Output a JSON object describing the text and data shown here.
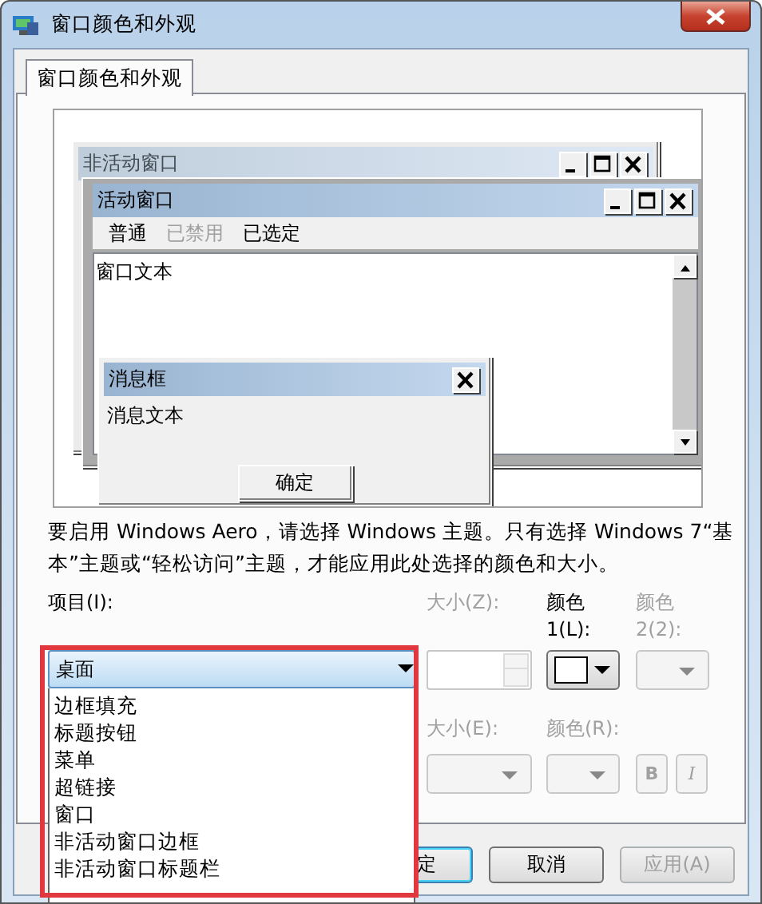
{
  "window": {
    "title": "窗口颜色和外观"
  },
  "tabs": [
    {
      "label": "窗口颜色和外观",
      "selected": true
    }
  ],
  "preview": {
    "inactive_window": {
      "title": "非活动窗口"
    },
    "active_window": {
      "title": "活动窗口",
      "menu": [
        {
          "label": "普通",
          "disabled": false
        },
        {
          "label": "已禁用",
          "disabled": true
        },
        {
          "label": "已选定",
          "disabled": false
        }
      ],
      "text": "窗口文本"
    },
    "message_box": {
      "title": "消息框",
      "text": "消息文本",
      "button": "确定"
    }
  },
  "note": "要启用 Windows Aero，请选择 Windows 主题。只有选择 Windows 7“基本”主题或“轻松访问”主题，才能应用此处选择的颜色和大小。",
  "item": {
    "label": "项目(I):",
    "value": "桌面",
    "expanded": true,
    "options": [
      {
        "label": "边框填充"
      },
      {
        "label": "标题按钮"
      },
      {
        "label": "菜单"
      },
      {
        "label": "超链接"
      },
      {
        "label": "窗口"
      },
      {
        "label": "非活动窗口边框"
      },
      {
        "label": "非活动窗口标题栏"
      }
    ]
  },
  "size": {
    "label": "大小(Z):",
    "disabled": true
  },
  "color1": {
    "label": "颜色 1(L):",
    "disabled": false
  },
  "color2": {
    "label": "颜色 2(2):",
    "disabled": true
  },
  "font_size": {
    "label": "大小(E):",
    "disabled": true
  },
  "font_color": {
    "label": "颜色(R):",
    "disabled": true
  },
  "bold": {
    "label": "B",
    "disabled": true
  },
  "italic": {
    "label": "I",
    "disabled": true
  },
  "buttons": [
    {
      "label": "定",
      "default": true,
      "disabled": false
    },
    {
      "label": "取消",
      "default": false,
      "disabled": false
    },
    {
      "label": "应用(A)",
      "default": false,
      "disabled": true
    }
  ]
}
